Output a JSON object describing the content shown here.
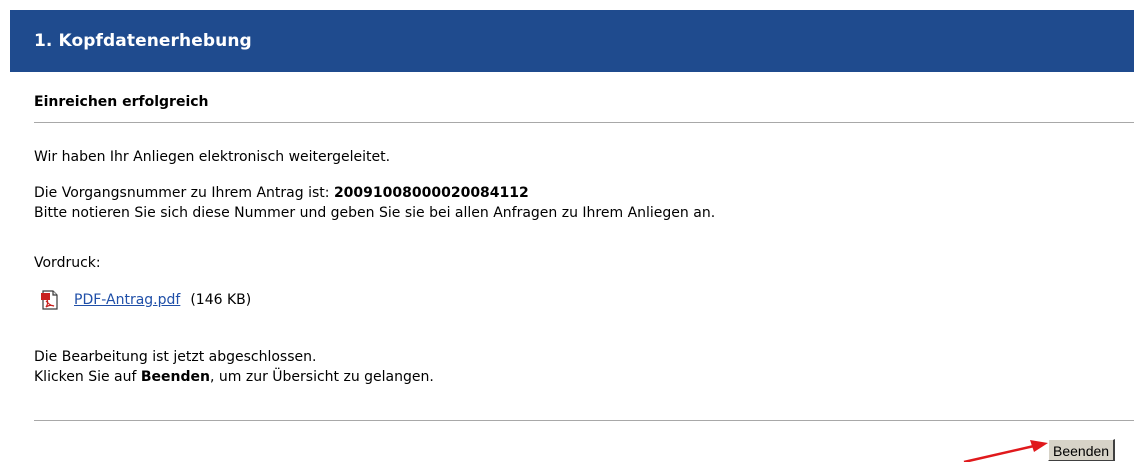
{
  "header": {
    "title": "1. Kopfdatenerhebung"
  },
  "section": {
    "title": "Einreichen erfolgreich"
  },
  "messages": {
    "forwarded": "Wir haben Ihr Anliegen elektronisch weitergeleitet.",
    "process_number_label": "Die Vorgangsnummer zu Ihrem Antrag ist: ",
    "process_number": "20091008000020084112",
    "note": "Bitte notieren Sie sich diese Nummer und geben Sie sie bei allen Anfragen zu Ihrem Anliegen an.",
    "form_label": "Vordruck:",
    "done": "Die Bearbeitung ist jetzt abgeschlossen.",
    "click_prefix": "Klicken Sie auf ",
    "click_bold": "Beenden",
    "click_suffix": ", um zur Übersicht zu gelangen."
  },
  "file": {
    "icon": "pdf-icon",
    "name": "PDF-Antrag.pdf",
    "size": "(146 KB)"
  },
  "actions": {
    "finish_label": "Beenden"
  },
  "colors": {
    "header_bg": "#1f4b8e",
    "link": "#1f4fa8",
    "arrow": "#e0191c"
  }
}
